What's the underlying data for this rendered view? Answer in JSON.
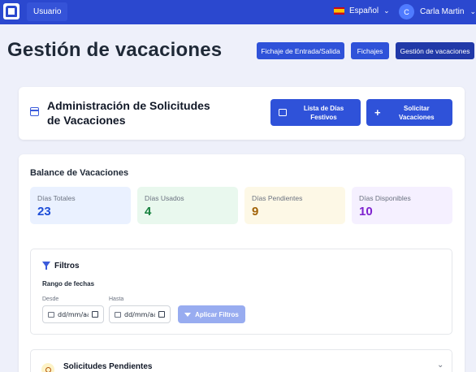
{
  "topbar": {
    "user_chip": "Usuario",
    "language": "Español",
    "user_initial": "C",
    "user_name": "Carla Martin"
  },
  "page": {
    "title": "Gestión de vacaciones",
    "nav": [
      "Fichaje de Entrada/Salida",
      "Fichajes",
      "Gestión de vacaciones"
    ]
  },
  "admin": {
    "title": "Administración de Solicitudes de Vacaciones",
    "holidays_button": "Lista de Días Festivos",
    "request_button": "Solicitar Vacaciones"
  },
  "balance": {
    "title": "Balance de Vacaciones",
    "stats": [
      {
        "label": "Días Totales",
        "value": "23"
      },
      {
        "label": "Días Usados",
        "value": "4"
      },
      {
        "label": "Días Pendientes",
        "value": "9"
      },
      {
        "label": "Días Disponibles",
        "value": "10"
      }
    ]
  },
  "filters": {
    "title": "Filtros",
    "range_label": "Rango de fechas",
    "from_label": "Desde",
    "to_label": "Hasta",
    "from_value": "dd/mm/aaaa",
    "to_value": "dd/mm/aaaa",
    "apply_button": "Aplicar Filtros"
  },
  "pending": {
    "title": "Solicitudes Pendientes"
  },
  "colors": {
    "topbar": "#2b48cf",
    "primary_button": "#2f52d9",
    "active_nav": "#2139a8"
  }
}
